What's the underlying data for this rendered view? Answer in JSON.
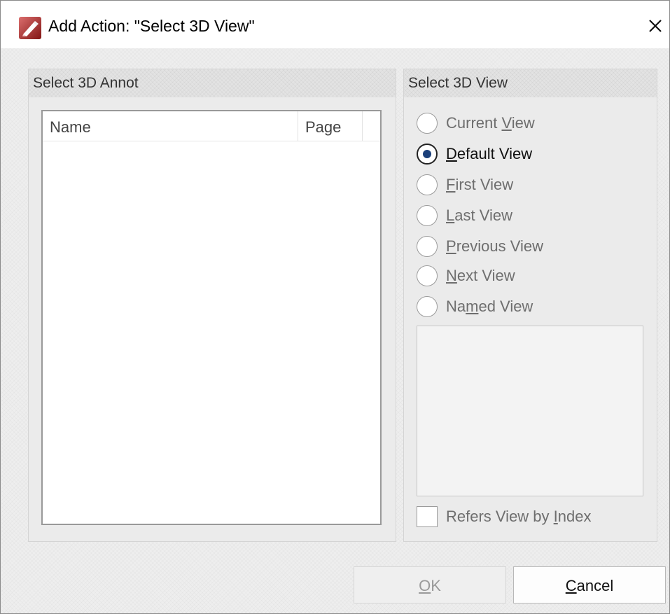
{
  "window": {
    "title": "Add Action: \"Select 3D View\"",
    "close_icon": "close-icon",
    "app_icon": "pdf-editor-app-icon",
    "brand_color": "#c8201f"
  },
  "left_panel": {
    "title": "Select 3D Annot",
    "columns": [
      "Name",
      "Page"
    ],
    "rows": []
  },
  "right_panel": {
    "title": "Select 3D View",
    "options": [
      {
        "pre": "Current ",
        "key": "V",
        "post": "iew",
        "checked": false
      },
      {
        "pre": "",
        "key": "D",
        "post": "efault View",
        "checked": true
      },
      {
        "pre": "",
        "key": "F",
        "post": "irst View",
        "checked": false
      },
      {
        "pre": "",
        "key": "L",
        "post": "ast View",
        "checked": false
      },
      {
        "pre": "",
        "key": "P",
        "post": "revious View",
        "checked": false
      },
      {
        "pre": "",
        "key": "N",
        "post": "ext View",
        "checked": false
      },
      {
        "pre": "Na",
        "key": "m",
        "post": "ed View",
        "checked": false
      }
    ],
    "refers_checkbox": {
      "pre": "Refers View by ",
      "key": "I",
      "post": "ndex",
      "checked": false
    }
  },
  "buttons": {
    "ok": {
      "key": "O",
      "post": "K"
    },
    "cancel": {
      "key": "C",
      "post": "ancel"
    }
  },
  "colors": {
    "radio_selected": "#1a3f7a"
  }
}
